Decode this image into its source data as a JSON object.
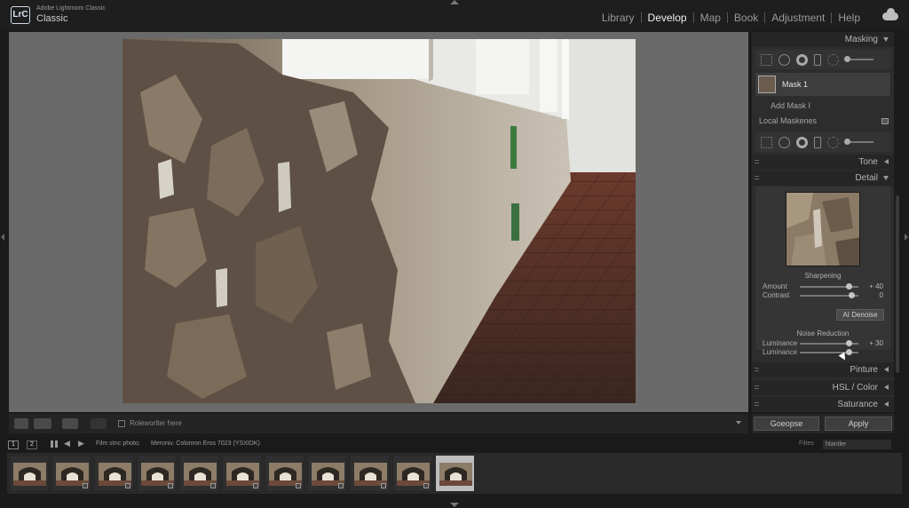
{
  "app": {
    "product": "Adobe Lightroom Classic",
    "catalog": "Classic",
    "logo": "LrC"
  },
  "modules": [
    {
      "label": "Library",
      "active": false
    },
    {
      "label": "Develop",
      "active": true
    },
    {
      "label": "Map",
      "active": false
    },
    {
      "label": "Book",
      "active": false
    },
    {
      "label": "Adjustment",
      "active": false
    },
    {
      "label": "Help",
      "active": false
    }
  ],
  "toolbar": {
    "filter_text": "Roleworlter here"
  },
  "right_panel": {
    "masking_header": "Masking",
    "mask_name": "Mask 1",
    "add_mask": "Add Mask I",
    "local_masks": "Local Maskenes",
    "tone_header": "Tone",
    "detail_header": "Detail",
    "sharpening": {
      "title": "Sharpening",
      "amount_label": "Amount",
      "amount_value": "+ 40",
      "amount_level": 0.83,
      "contrast_label": "Contrast",
      "contrast_value": "0",
      "contrast_level": 0.88
    },
    "ai_denoise": "AI Denoise",
    "noise_reduction": {
      "title": "Noise Reduction",
      "luminance_label": "Luminance",
      "luminance_value": "+ 30",
      "luminance_level": 0.83,
      "luminance2_label": "Luminance",
      "luminance2_level": 0.83
    },
    "collapsed": [
      "Pinture",
      "HSL / Color",
      "Saturance"
    ],
    "buttons": {
      "left": "Goeopse",
      "right": "Apply"
    }
  },
  "filmstrip_bar": {
    "page1": "1",
    "page2": "2",
    "source_label": "Film strıc photo:",
    "source_path": "Meroniv. Colonron Eros 7023 (YSXIDK)",
    "filter_label": "Filtes",
    "filter_value": "htantler"
  },
  "filmstrip": {
    "count": 11,
    "selected_index": 10
  }
}
